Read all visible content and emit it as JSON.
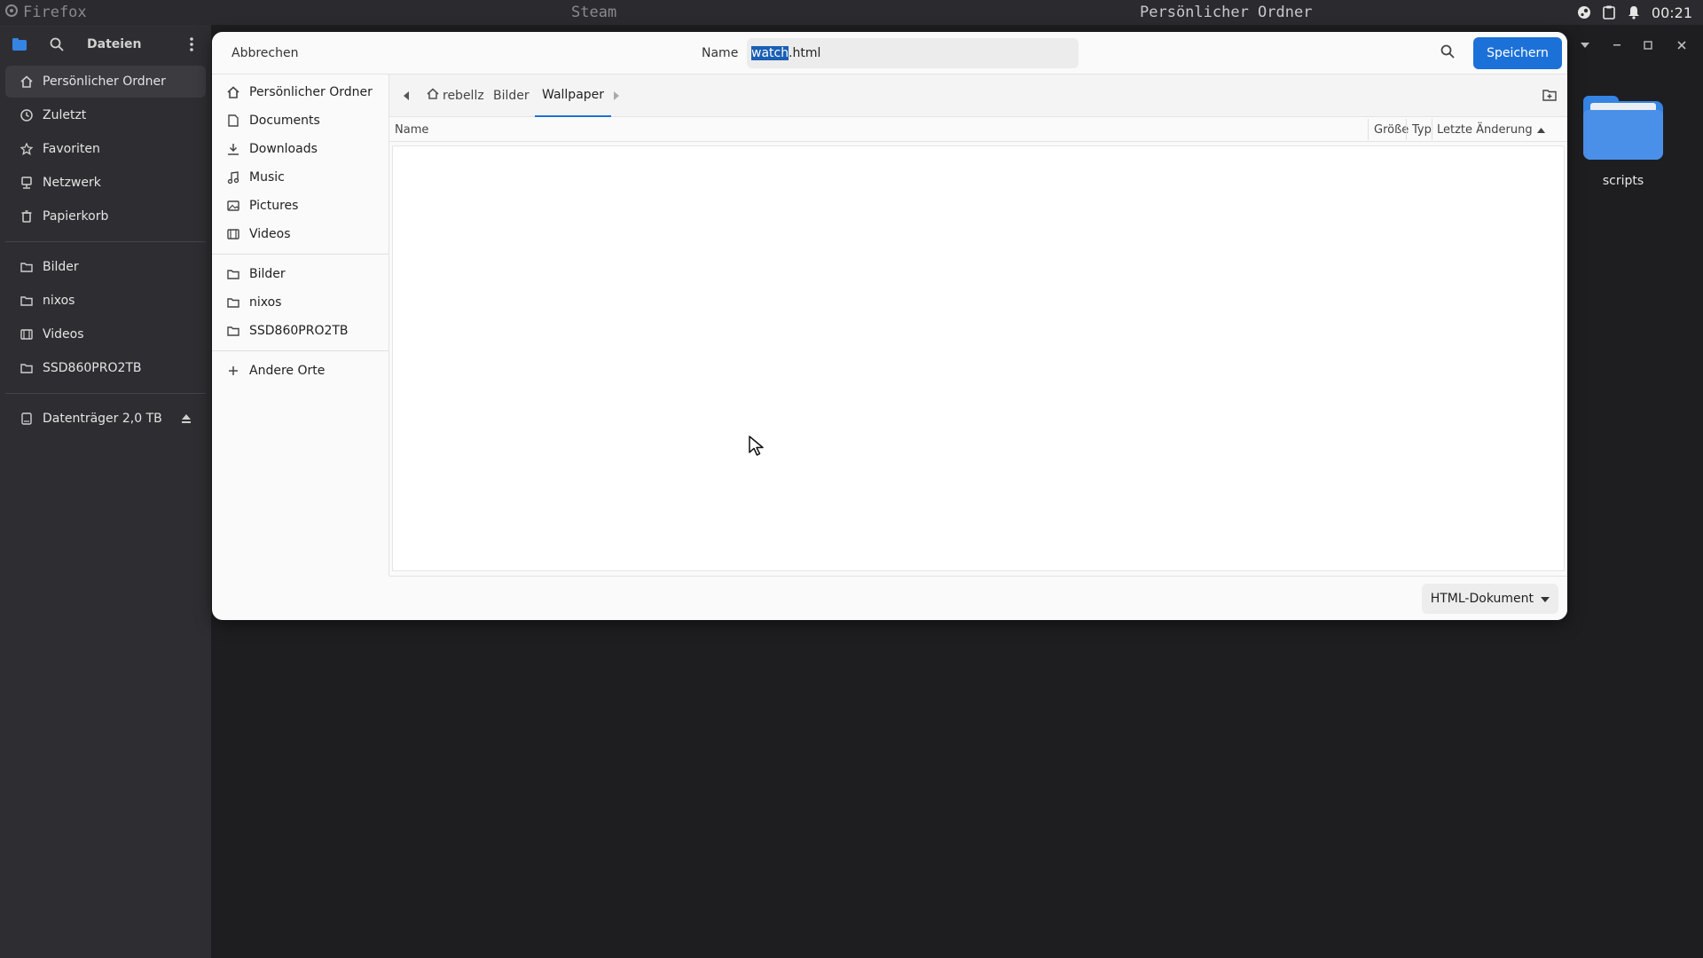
{
  "topbar": {
    "workspace_1": "Firefox",
    "workspace_2": "Steam",
    "window_title": "Persönlicher Ordner",
    "clock": "00:21"
  },
  "file_manager": {
    "title": "Dateien",
    "places": [
      {
        "label": "Persönlicher Ordner",
        "icon": "home-icon"
      },
      {
        "label": "Zuletzt",
        "icon": "recent-icon"
      },
      {
        "label": "Favoriten",
        "icon": "star-icon"
      },
      {
        "label": "Netzwerk",
        "icon": "network-icon"
      },
      {
        "label": "Papierkorb",
        "icon": "trash-icon"
      }
    ],
    "bookmarks": [
      {
        "label": "Bilder",
        "icon": "folder-icon"
      },
      {
        "label": "nixos",
        "icon": "folder-icon"
      },
      {
        "label": "Videos",
        "icon": "video-icon"
      },
      {
        "label": "SSD860PRO2TB",
        "icon": "folder-icon"
      }
    ],
    "drives": [
      {
        "label": "Datenträger 2,0 TB",
        "icon": "drive-icon"
      }
    ]
  },
  "desktop": {
    "icons": [
      {
        "label": "scripts",
        "icon": "folder-icon"
      }
    ]
  },
  "dialog": {
    "cancel_label": "Abbrechen",
    "name_label": "Name",
    "filename_selected": "watch",
    "filename_rest": ".html",
    "save_label": "Speichern",
    "sidebar_places": [
      {
        "label": "Persönlicher Ordner",
        "icon": "home-icon"
      },
      {
        "label": "Documents",
        "icon": "document-icon"
      },
      {
        "label": "Downloads",
        "icon": "download-icon"
      },
      {
        "label": "Music",
        "icon": "music-icon"
      },
      {
        "label": "Pictures",
        "icon": "picture-icon"
      },
      {
        "label": "Videos",
        "icon": "video-icon"
      }
    ],
    "sidebar_bookmarks": [
      {
        "label": "Bilder",
        "icon": "folder-icon"
      },
      {
        "label": "nixos",
        "icon": "folder-icon"
      },
      {
        "label": "SSD860PRO2TB",
        "icon": "folder-icon"
      }
    ],
    "other_locations": "Andere Orte",
    "breadcrumbs": [
      "rebellz",
      "Bilder",
      "Wallpaper"
    ],
    "columns": {
      "name": "Name",
      "size": "Größe",
      "type": "Typ",
      "modified": "Letzte Änderung"
    },
    "filter": "HTML-Dokument"
  },
  "colors": {
    "accent": "#1c71d8",
    "selection": "#1a5fb4",
    "folder": "#3584e4"
  }
}
